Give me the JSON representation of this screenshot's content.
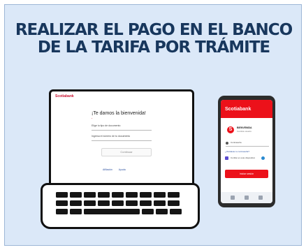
{
  "title": {
    "line1": "REALIZAR EL PAGO EN EL BANCO",
    "line2": "DE LA TARIFA POR TRÁMITE"
  },
  "laptop": {
    "brand": "Scotiabank",
    "heading": "¡Te damos la bienvenida!",
    "field1_label": "Elige tu tipo de documento",
    "field2_label": "Ingresa el número de tu documento",
    "continue_label": "Continuar",
    "link1": "Afiliación",
    "link2": "Ayuda"
  },
  "phone": {
    "brand": "Scotiabank",
    "logo_letter": "S",
    "name": "BIENVENIDA",
    "sub": "Cambia usuario",
    "field": "Contraseña",
    "link": "¿Olvidaste tu contraseña?",
    "checkbox": "Confiar en este dispositivo",
    "button": "Iniciar sesión"
  },
  "colors": {
    "background": "#dbe8f8",
    "title": "#18375d",
    "brand_red": "#ec111a"
  }
}
